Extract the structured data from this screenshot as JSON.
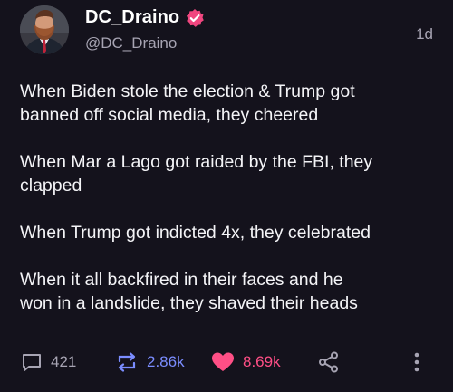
{
  "author": {
    "display_name": "DC_Draino",
    "handle": "@DC_Draino",
    "timestamp": "1d",
    "verified_color": "#f0467f"
  },
  "post": {
    "paragraphs": [
      "When Biden stole the election & Trump got\nbanned off social media, they cheered",
      "When Mar a Lago got raided by the FBI, they\nclapped",
      "When Trump got indicted 4x, they celebrated",
      "When it all backfired in their faces and he\nwon in a landslide, they shaved their heads"
    ]
  },
  "actions": {
    "reply_count": "421",
    "repost_count": "2.86k",
    "like_count": "8.69k"
  },
  "colors": {
    "background": "#14121c",
    "repost_accent": "#7b8dff",
    "like_accent": "#ff4f86",
    "muted": "#a7a4b3"
  },
  "icons": [
    "reply-icon",
    "repost-icon",
    "heart-icon",
    "share-icon",
    "more-options-icon",
    "verified-badge-icon"
  ]
}
